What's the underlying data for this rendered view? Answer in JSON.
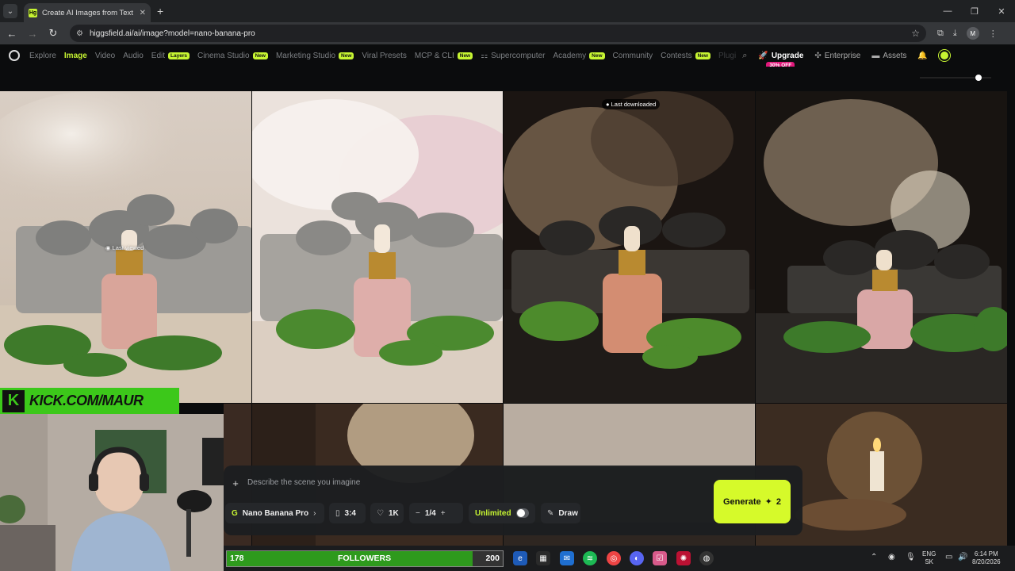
{
  "browser": {
    "tab_title": "Create AI Images from Text & P",
    "tab_favicon": "Hg",
    "url": "higgsfield.ai/ai/image?model=nano-banana-pro"
  },
  "nav": {
    "items": [
      {
        "label": "Explore",
        "badge": ""
      },
      {
        "label": "Image",
        "badge": "",
        "active": true
      },
      {
        "label": "Video",
        "badge": ""
      },
      {
        "label": "Audio",
        "badge": ""
      },
      {
        "label": "Edit",
        "badge": "Layers"
      },
      {
        "label": "Cinema Studio",
        "badge": "New"
      },
      {
        "label": "Marketing Studio",
        "badge": "New"
      },
      {
        "label": "Viral Presets",
        "badge": ""
      },
      {
        "label": "MCP & CLI",
        "badge": "New"
      },
      {
        "label": "Supercomputer",
        "badge": ""
      },
      {
        "label": "Academy",
        "badge": "New"
      },
      {
        "label": "Community",
        "badge": ""
      },
      {
        "label": "Contests",
        "badge": "New"
      },
      {
        "label": "Plugi",
        "badge": ""
      }
    ],
    "upgrade": "Upgrade",
    "upgrade_discount": "30% OFF",
    "enterprise": "Enterprise",
    "assets": "Assets"
  },
  "grid": {
    "last_viewed": "Last viewed",
    "last_downloaded": "Last downloaded"
  },
  "overlay": {
    "kick_text": "KICK.COM/MAUR",
    "followers_count": "178",
    "followers_label": "FOLLOWERS",
    "followers_target": "200",
    "followers_progress": 0.89
  },
  "prompt": {
    "placeholder": "Describe the scene you imagine",
    "model": "Nano Banana Pro",
    "model_icon": "G",
    "aspect": "3:4",
    "quality": "1K",
    "batch": "1/4",
    "unlimited": "Unlimited",
    "draw": "Draw",
    "generate": "Generate",
    "generate_cost": "2"
  },
  "taskbar": {
    "lang": "ENG",
    "region": "SK",
    "time": "6:14 PM",
    "date": "8/20/2026"
  },
  "colors": {
    "accent": "#c6f432",
    "generate": "#d6fa2a",
    "discount": "#e0187a",
    "kick": "#3cc81a"
  }
}
